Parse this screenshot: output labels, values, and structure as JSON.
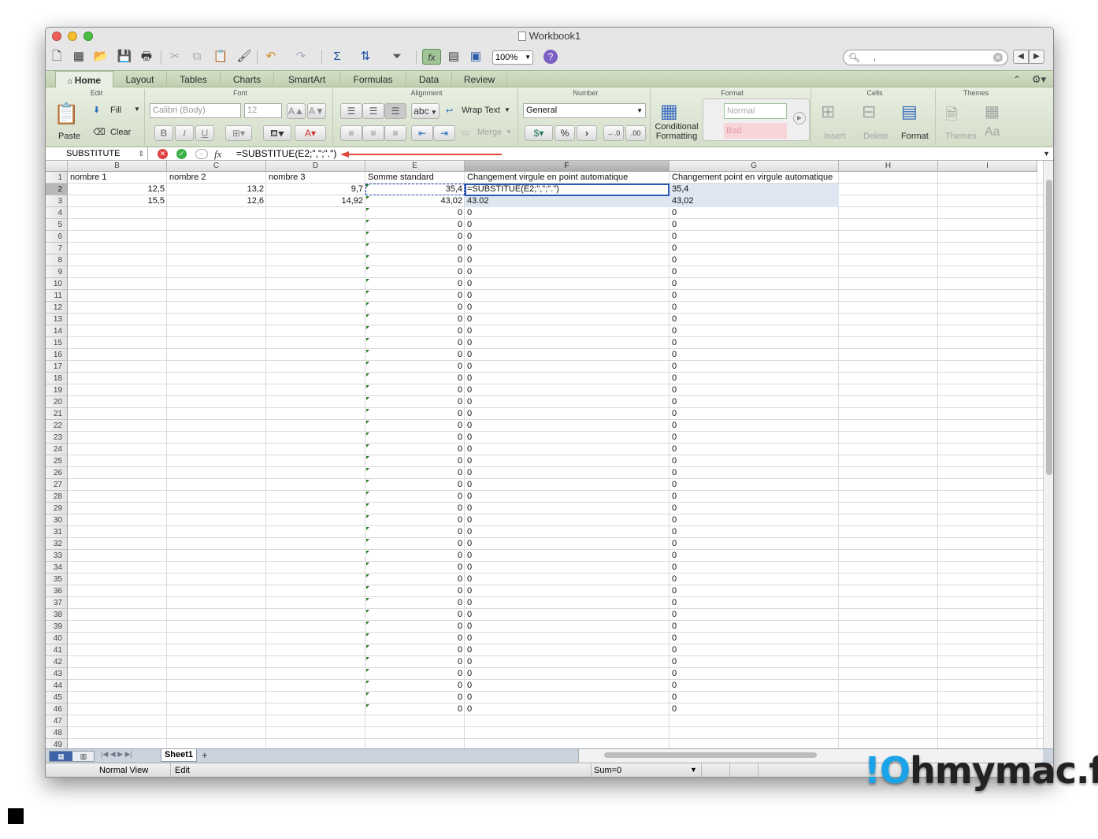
{
  "window": {
    "title": "Workbook1"
  },
  "toolbar": {
    "zoom": "100%",
    "search_value": ","
  },
  "ribbon_tabs": [
    "Home",
    "Layout",
    "Tables",
    "Charts",
    "SmartArt",
    "Formulas",
    "Data",
    "Review"
  ],
  "ribbon": {
    "edit": {
      "title": "Edit",
      "paste": "Paste",
      "fill": "Fill",
      "clear": "Clear"
    },
    "font": {
      "title": "Font",
      "name": "Calibri (Body)",
      "size": "12",
      "bold": "B",
      "italic": "I",
      "underline": "U",
      "grow": "A▲",
      "shrink": "A▼"
    },
    "alignment": {
      "title": "Alignment",
      "abc": "abc",
      "wrap_text": "Wrap Text",
      "merge": "Merge"
    },
    "number": {
      "title": "Number",
      "format": "General",
      "percent": "%",
      "comma": "›",
      "inc_dec": "←.0",
      "dec_dec": ".00"
    },
    "format": {
      "title": "Format",
      "conditional": "Conditional",
      "formatting": "Formatting",
      "style_normal": "Normal",
      "style_bad": "Bad"
    },
    "cells": {
      "title": "Cells",
      "insert": "Insert",
      "delete": "Delete",
      "format": "Format"
    },
    "themes": {
      "title": "Themes",
      "themes": "Themes",
      "aa": "Aa"
    }
  },
  "formula_bar": {
    "name_box": "SUBSTITUTE",
    "fx": "fx",
    "formula": "=SUBSTITUE(E2;\",\";\".\")"
  },
  "columns": [
    "B",
    "C",
    "D",
    "E",
    "F",
    "G",
    "H",
    "I"
  ],
  "selected_column": "F",
  "selected_row": 2,
  "rows": {
    "first": 1,
    "last": 49
  },
  "cells": {
    "header_row": [
      "nombre 1",
      "nombre 2",
      "nombre 3",
      "Somme standard",
      "Changement virgule en point automatique",
      "Changement point en virgule automatique"
    ],
    "row2": [
      "12,5",
      "13,2",
      "9,7",
      "35,4",
      "=SUBSTITUE(E2;\",\";\".\")",
      "35,4"
    ],
    "row3": [
      "15,5",
      "12,6",
      "14,92",
      "43,02",
      "43.02",
      "43,02"
    ],
    "zero_fill": {
      "from_row": 4,
      "to_row": 46,
      "value": "0"
    }
  },
  "sheets": [
    "Sheet1"
  ],
  "status": {
    "view": "Normal View",
    "mode": "Edit",
    "sum": "Sum=0"
  },
  "watermark": {
    "text_lead": "!O",
    "text_rest": "hmymac.fr",
    "color_lead": "#1aa3e8",
    "color_rest": "#222222"
  },
  "colors": {
    "ribbon_green": "#d3dfc6",
    "selection_fill": "#dde6f1",
    "arrow_red": "#e24a3d",
    "error_tri": "#1e7a1e"
  }
}
